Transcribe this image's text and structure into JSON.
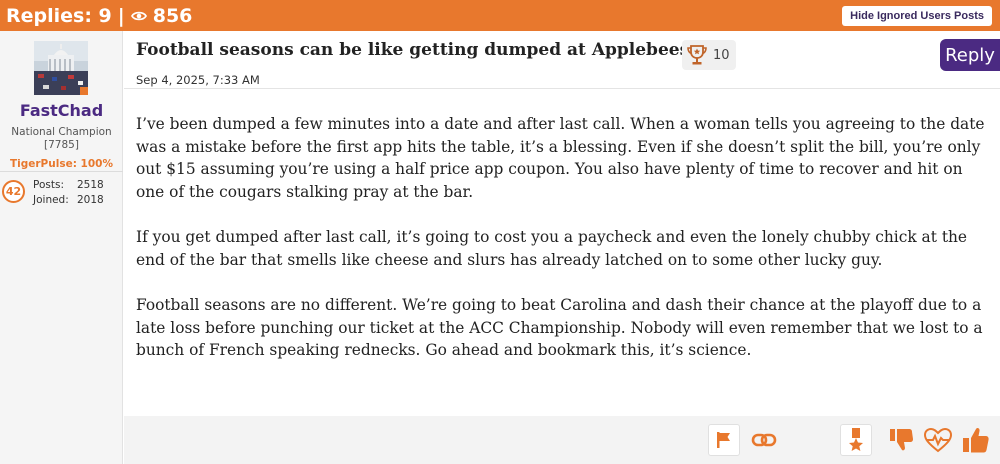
{
  "topbar": {
    "replies_label": "Replies: 9",
    "separator": "|",
    "views": "856",
    "hide_ignored_label": "Hide Ignored Users Posts"
  },
  "author": {
    "username": "FastChad",
    "title": "National Champion",
    "id": "[7785]",
    "tigerpulse": "TigerPulse: 100%",
    "badge_number": "42",
    "posts_label": "Posts:",
    "posts": "2518",
    "joined_label": "Joined:",
    "joined": "2018"
  },
  "post": {
    "title": "Football seasons can be like getting dumped at Applebees",
    "trophy_count": "10",
    "reply_label": "Reply",
    "date": "Sep 4, 2025, 7:33 AM",
    "paragraphs": [
      "I’ve been dumped a few minutes into a date and after last call. When a woman tells you agreeing to the date was a mistake before the first app hits the table, it’s a blessing. Even if she doesn’t split the bill, you’re only out $15 assuming you’re using a half price app coupon. You also have plenty of time to recover and hit on one of the cougars stalking pray at the bar.",
      "If you get dumped after last call, it’s going to cost you a paycheck and even the lonely chubby chick at the end of the bar that smells like cheese and slurs has already latched on to some other lucky guy.",
      "Football seasons are no different. We’re going to beat Carolina and dash their chance at the playoff due to a late loss before punching our ticket at the ACC Championship. Nobody will even remember that we lost to a bunch of French speaking rednecks. Go ahead and bookmark this, it’s science."
    ]
  },
  "colors": {
    "accent_orange": "#e8782d",
    "accent_purple": "#4b2a82"
  },
  "icons": [
    "eye-icon",
    "trophy-icon",
    "flag-icon",
    "link-icon",
    "award-icon",
    "thumbs-down-icon",
    "heart-pulse-icon",
    "thumbs-up-icon"
  ]
}
